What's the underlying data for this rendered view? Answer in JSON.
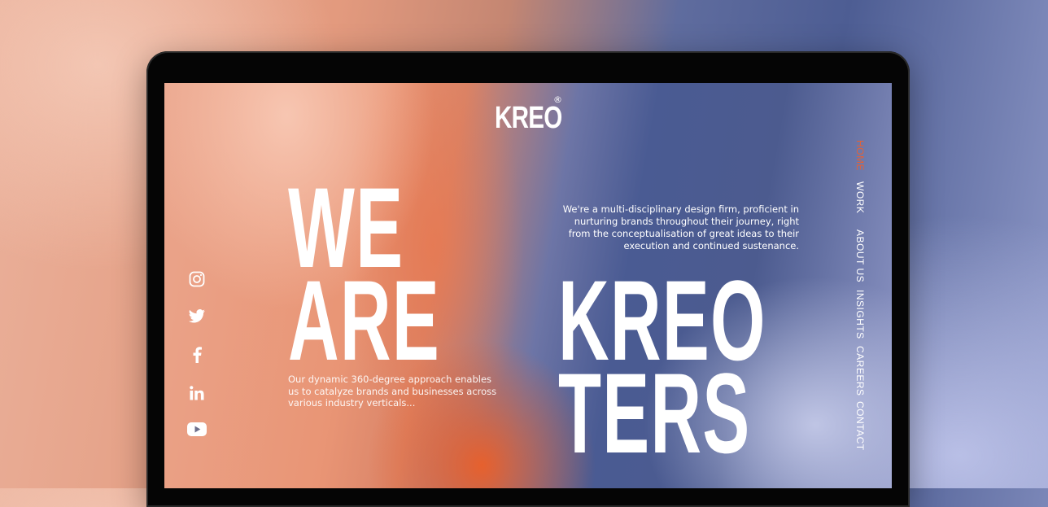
{
  "brand": {
    "name": "KREO",
    "reg": "®"
  },
  "headline": {
    "line1": "WE",
    "line2": "ARE",
    "line3": "KREO",
    "line4": "TERS"
  },
  "intro_text": "We're a multi-disciplinary design firm, proficient in nurturing brands throughout their journey, right from the conceptualisation of great ideas to their execution and continued sustenance.",
  "approach_text": "Our dynamic 360-degree approach enables us to catalyze brands and businesses across various industry verticals...",
  "nav": {
    "items": [
      {
        "label": "HOME",
        "active": true
      },
      {
        "label": "WORK",
        "active": false
      },
      {
        "label": "ABOUT US",
        "active": false
      },
      {
        "label": "INSIGHTS",
        "active": false
      },
      {
        "label": "CAREERS",
        "active": false
      },
      {
        "label": "CONTACT",
        "active": false
      }
    ]
  },
  "social": [
    "instagram-icon",
    "twitter-icon",
    "facebook-icon",
    "linkedin-icon",
    "youtube-icon"
  ],
  "colors": {
    "accent": "#e0623a",
    "text": "#ffffff",
    "device": "#050505"
  }
}
